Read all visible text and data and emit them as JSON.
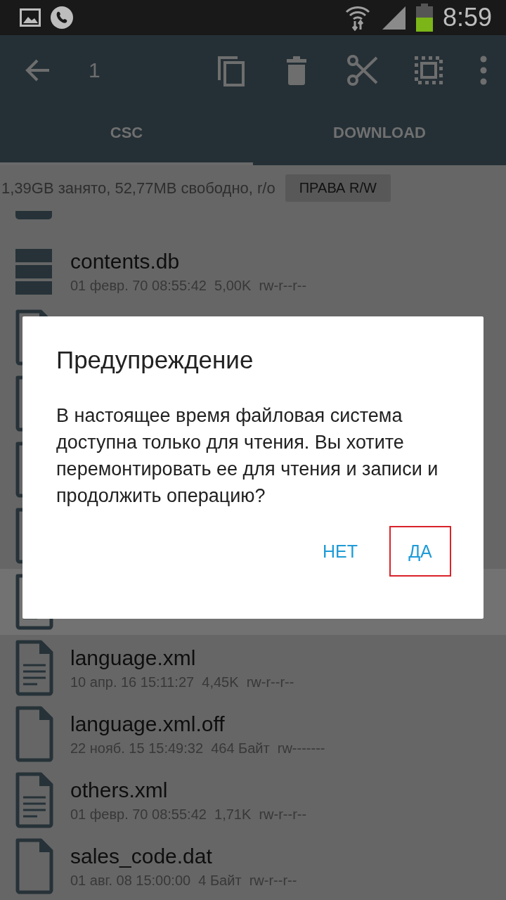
{
  "status_bar": {
    "time": "8:59"
  },
  "toolbar": {
    "selection_count": "1"
  },
  "tabs": [
    {
      "label": "CSC",
      "selected": true
    },
    {
      "label": "DOWNLOAD",
      "selected": false
    }
  ],
  "info_bar": {
    "text": "1,39GB занято, 52,77MB свободно, r/o",
    "button": "ПРАВА R/W"
  },
  "files": [
    {
      "kind": "folder",
      "selected": false
    },
    {
      "kind": "database",
      "name": "contents.db",
      "meta": "01 февр. 70 08:55:42  5,00K  rw-r--r--",
      "selected": false
    },
    {
      "kind": "text",
      "selected": false
    },
    {
      "kind": "text",
      "selected": false
    },
    {
      "kind": "text",
      "selected": false
    },
    {
      "kind": "text",
      "selected": false
    },
    {
      "kind": "text",
      "selected": true
    },
    {
      "kind": "text",
      "name": "language.xml",
      "meta": "10 апр. 16 15:11:27  4,45K  rw-r--r--",
      "selected": false
    },
    {
      "kind": "blank",
      "name": "language.xml.off",
      "meta": "22 нояб. 15 15:49:32  464 Байт  rw-------",
      "selected": false
    },
    {
      "kind": "text",
      "name": "others.xml",
      "meta": "01 февр. 70 08:55:42  1,71K  rw-r--r--",
      "selected": false
    },
    {
      "kind": "blank",
      "name": "sales_code.dat",
      "meta": "01 авг. 08 15:00:00  4 Байт  rw-r--r--",
      "selected": false
    }
  ],
  "dialog": {
    "title": "Предупреждение",
    "message": "В настоящее время файловая система доступна только для чтения. Вы хотите перемонтировать ее для чтения и записи и продолжить операцию?",
    "buttons": [
      {
        "label": "НЕТ",
        "highlighted": false
      },
      {
        "label": "ДА",
        "highlighted": true
      }
    ]
  }
}
